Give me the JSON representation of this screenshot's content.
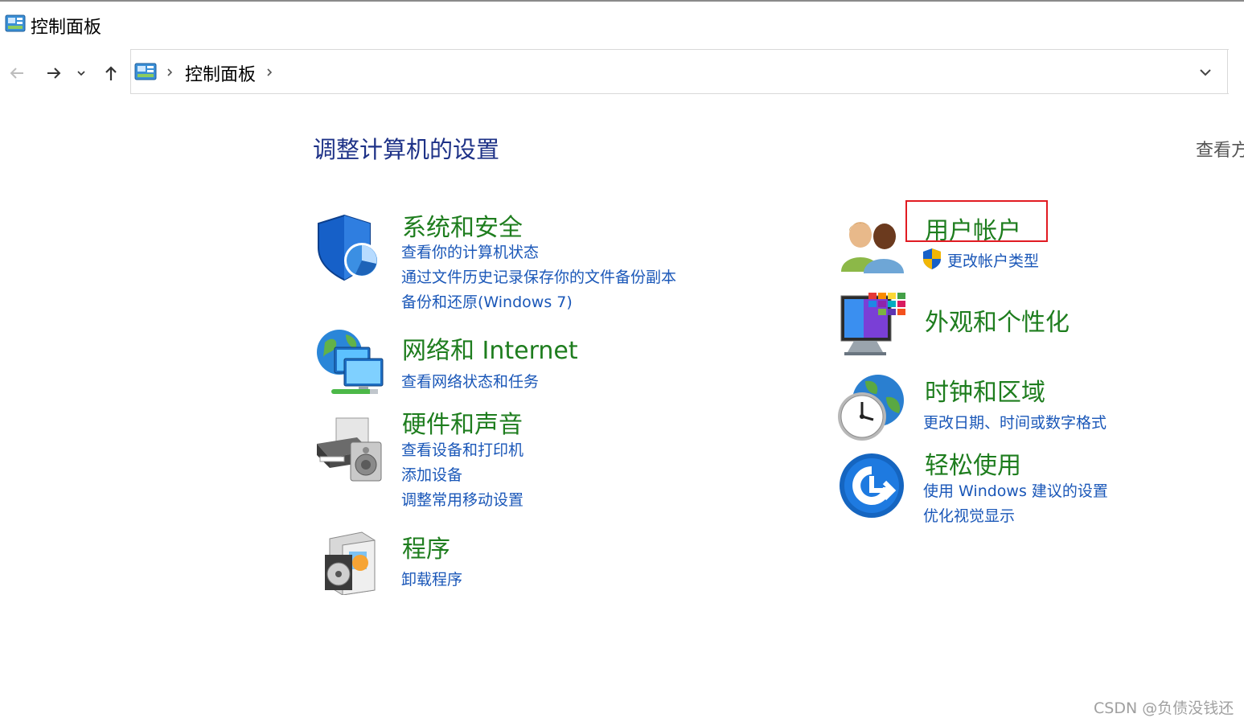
{
  "window": {
    "title": "控制面板"
  },
  "address_bar": {
    "crumb": "控制面板"
  },
  "main": {
    "heading": "调整计算机的设置",
    "view_by": "查看方"
  },
  "categories": {
    "system": {
      "title": "系统和安全",
      "links": [
        "查看你的计算机状态",
        "通过文件历史记录保存你的文件备份副本",
        "备份和还原(Windows 7)"
      ]
    },
    "network": {
      "title": "网络和 Internet",
      "links": [
        "查看网络状态和任务"
      ]
    },
    "hardware": {
      "title": "硬件和声音",
      "links": [
        "查看设备和打印机",
        "添加设备",
        "调整常用移动设置"
      ]
    },
    "programs": {
      "title": "程序",
      "links": [
        "卸载程序"
      ]
    },
    "users": {
      "title": "用户帐户",
      "links": [
        "更改帐户类型"
      ]
    },
    "appearance": {
      "title": "外观和个性化",
      "links": []
    },
    "clock": {
      "title": "时钟和区域",
      "links": [
        "更改日期、时间或数字格式"
      ]
    },
    "ease": {
      "title": "轻松使用",
      "links": [
        "使用 Windows 建议的设置",
        "优化视觉显示"
      ]
    }
  },
  "watermark": "CSDN @负债没钱还",
  "colors": {
    "heading": "#1e3287",
    "category": "#1e7d1e",
    "link": "#1a57b8",
    "highlight": "#e11b22"
  }
}
